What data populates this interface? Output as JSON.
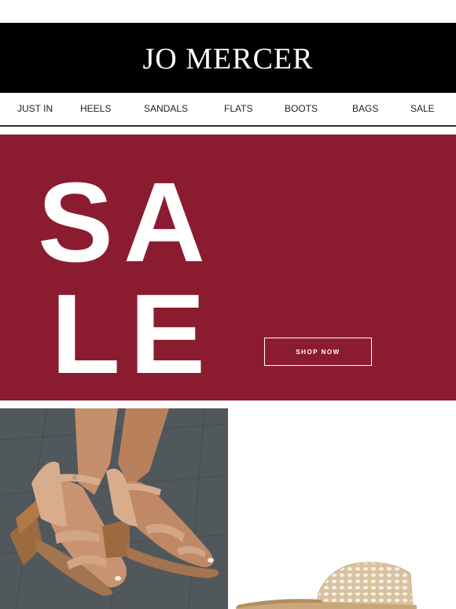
{
  "brand": {
    "name": "JO MERCER"
  },
  "nav": {
    "items": [
      {
        "label": "JUST IN"
      },
      {
        "label": "HEELS"
      },
      {
        "label": "SANDALS"
      },
      {
        "label": "FLATS"
      },
      {
        "label": "BOOTS"
      },
      {
        "label": "BAGS"
      },
      {
        "label": "SALE"
      }
    ]
  },
  "banner": {
    "letters": [
      "S",
      "A",
      "L",
      "E"
    ],
    "cta_label": "SHOP NOW",
    "background": "#8b1c2f"
  },
  "products": [
    {
      "image": "tan-block-heel-sandal-on-model-photo"
    },
    {
      "image": "gold-woven-mule-sandal-photo"
    }
  ]
}
